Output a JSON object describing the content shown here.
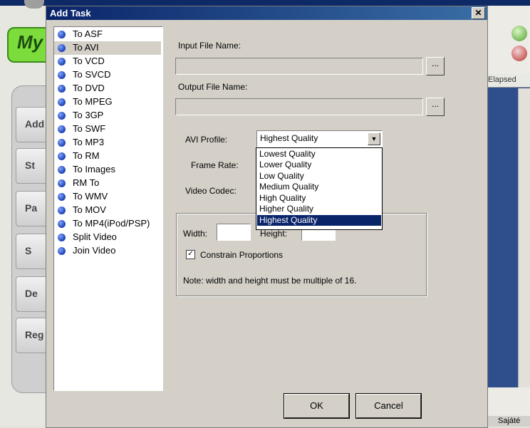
{
  "background_app": {
    "logo_text": "My",
    "left_buttons": [
      "Add",
      "St",
      "Pa",
      "S",
      "De",
      "Reg"
    ],
    "elapsed_header": "Elapsed",
    "taskbar_text": "Sajáté"
  },
  "dialog": {
    "title": "Add Task",
    "close_label": "✕",
    "tasks": [
      "To ASF",
      "To AVI",
      "To VCD",
      "To SVCD",
      "To DVD",
      "To MPEG",
      "To 3GP",
      "To SWF",
      "To MP3",
      "To RM",
      "To Images",
      "RM To",
      "To WMV",
      "To MOV",
      "To MP4(iPod/PSP)",
      "Split Video",
      "Join Video"
    ],
    "selected_task": "To AVI",
    "input_file_label": "Input File Name:",
    "input_file_value": "",
    "output_file_label": "Output File Name:",
    "output_file_value": "",
    "browse_label": "...",
    "avi_profile_label": "AVI Profile:",
    "avi_profile_value": "Highest Quality",
    "profile_options": [
      "Lowest Quality",
      "Lower Quality",
      "Low  Quality",
      "Medium Quality",
      "High Quality",
      "Higher Quality",
      "Highest Quality"
    ],
    "frame_rate_label": "Frame Rate:",
    "video_codec_label": "Video Codec:",
    "width_label": "Width:",
    "height_label": "Height:",
    "constrain_label": "Constrain Proportions",
    "constrain_checked": "✓",
    "note": "Note: width and height must be multiple of 16.",
    "ok_label": "OK",
    "cancel_label": "Cancel"
  }
}
